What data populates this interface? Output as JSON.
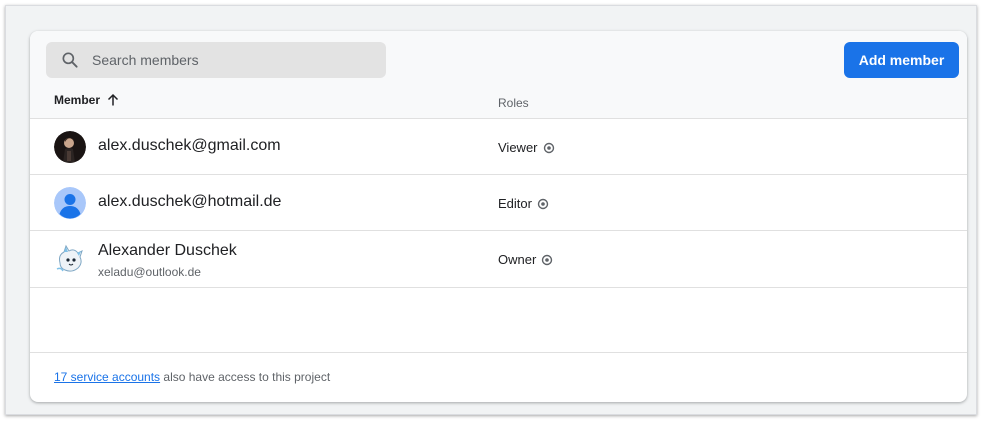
{
  "search": {
    "placeholder": "Search members",
    "icon": "search-icon"
  },
  "toolbar": {
    "add_member_label": "Add member",
    "accent": "#1a73e8"
  },
  "table": {
    "columns": {
      "member": "Member",
      "member_sort": "ascending",
      "roles": "Roles"
    },
    "rows": [
      {
        "name": "alex.duschek@gmail.com",
        "email": "",
        "role": "Viewer",
        "avatar": "photo"
      },
      {
        "name": "alex.duschek@hotmail.de",
        "email": "",
        "role": "Editor",
        "avatar": "default-person"
      },
      {
        "name": "Alexander Duschek",
        "email": "xeladu@outlook.de",
        "role": "Owner",
        "avatar": "creature-illustration"
      }
    ]
  },
  "footer": {
    "link_text": "17 service accounts",
    "rest_text": " also have access to this project"
  }
}
